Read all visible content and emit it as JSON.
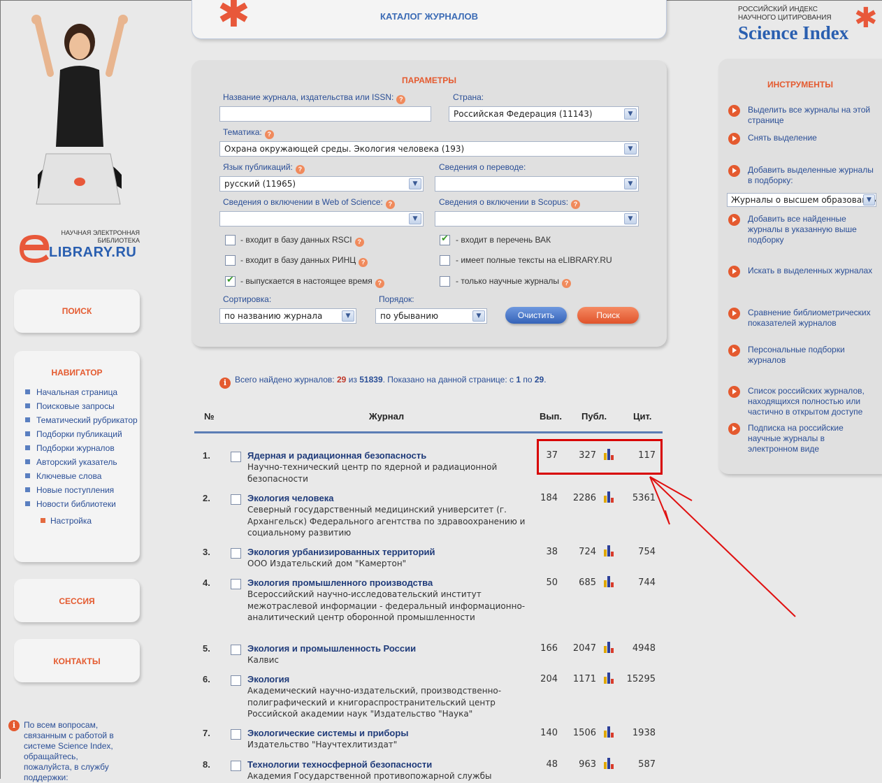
{
  "catalog": {
    "title": "КАТАЛОГ ЖУРНАЛОВ"
  },
  "library": {
    "logo_small": "НАУЧНАЯ ЭЛЕКТРОННАЯ БИБЛИОТЕКА",
    "logo_big": "LIBRARY.RU",
    "logo_letter": "e"
  },
  "science_index": {
    "small": "РОССИЙСКИЙ ИНДЕКС НАУЧНОГО ЦИТИРОВАНИЯ",
    "big": "Science Index"
  },
  "left": {
    "search_label": "ПОИСК",
    "navigator_title": "НАВИГАТОР",
    "navigator_items": [
      "Начальная страница",
      "Поисковые запросы",
      "Тематический рубрикатор",
      "Подборки публикаций",
      "Подборки журналов",
      "Авторский указатель",
      "Ключевые слова",
      "Новые поступления",
      "Новости библиотеки"
    ],
    "settings_label": "Настройка",
    "session_label": "СЕССИЯ",
    "contacts_label": "КОНТАКТЫ",
    "help_text": "По всем вопросам, связанным с работой в системе Science Index, обращайтесь, пожалуйста, в службу поддержки:"
  },
  "params": {
    "title": "ПАРАМЕТРЫ",
    "journal_name_label": "Название журнала, издательства или ISSN:",
    "journal_name_value": "",
    "country_label": "Страна:",
    "country_value": "Российская Федерация  (11143)",
    "topic_label": "Тематика:",
    "topic_value": "Охрана окружающей среды. Экология человека  (193)",
    "language_label": "Язык публикаций:",
    "language_value": "русский  (11965)",
    "translation_label": "Сведения о переводе:",
    "translation_value": "",
    "wos_label": "Сведения о включении в Web of Science:",
    "wos_value": "",
    "scopus_label": "Сведения о включении в Scopus:",
    "scopus_value": "",
    "checkboxes": [
      {
        "label": "- входит в базу данных RSCI",
        "checked": false,
        "help": true
      },
      {
        "label": "- входит в перечень ВАК",
        "checked": true,
        "help": false
      },
      {
        "label": "- входит в базу данных РИНЦ",
        "checked": false,
        "help": true
      },
      {
        "label": "- имеет полные тексты на eLIBRARY.RU",
        "checked": false,
        "help": false
      },
      {
        "label": "- выпускается в настоящее время",
        "checked": true,
        "help": true
      },
      {
        "label": "- только научные журналы",
        "checked": false,
        "help": true
      }
    ],
    "sort_label": "Сортировка:",
    "sort_value": "по названию журнала",
    "order_label": "Порядок:",
    "order_value": "по убыванию",
    "clear_button": "Очистить",
    "search_button": "Поиск",
    "help_mark": "?",
    "arrow_glyph": "▼"
  },
  "summary": {
    "prefix": "Всего найдено журналов:",
    "found": "29",
    "of": "из",
    "total": "51839",
    "shown_prefix": ". Показано на данной странице: с",
    "from": "1",
    "to_word": "по",
    "to": "29",
    "end": "."
  },
  "table": {
    "headers": {
      "num": "№",
      "journal": "Журнал",
      "issues": "Вып.",
      "pubs": "Публ.",
      "cites": "Цит."
    },
    "rows": [
      {
        "num": "1.",
        "title": "Ядерная и радиационная безопасность",
        "desc": "Научно-технический центр по ядерной и радиационной безопасности",
        "issues": "37",
        "pubs": "327",
        "cites": "117"
      },
      {
        "num": "2.",
        "title": "Экология человека",
        "desc": "Северный государственный медицинский университет (г. Архангельск) Федерального агентства по здравоохранению и социальному развитию",
        "issues": "184",
        "pubs": "2286",
        "cites": "5361"
      },
      {
        "num": "3.",
        "title": "Экология урбанизированных территорий",
        "desc": "ООО Издательский дом \"Камертон\"",
        "issues": "38",
        "pubs": "724",
        "cites": "754"
      },
      {
        "num": "4.",
        "title": "Экология промышленного производства",
        "desc": "Всероссийский научно-исследовательский институт межотраслевой информации - федеральный информационно-аналитический центр оборонной промышленности",
        "issues": "50",
        "pubs": "685",
        "cites": "744"
      },
      {
        "num": "5.",
        "title": "Экология и промышленность России",
        "desc": "Калвис",
        "issues": "166",
        "pubs": "2047",
        "cites": "4948"
      },
      {
        "num": "6.",
        "title": "Экология",
        "desc": "Академический научно-издательский, производственно-полиграфический и книгораспространительский центр Российской академии наук \"Издательство \"Наука\"",
        "issues": "204",
        "pubs": "1171",
        "cites": "15295"
      },
      {
        "num": "7.",
        "title": "Экологические системы и приборы",
        "desc": "Издательство \"Научтехлитиздат\"",
        "issues": "140",
        "pubs": "1506",
        "cites": "1938"
      },
      {
        "num": "8.",
        "title": "Технологии техносферной безопасности",
        "desc": "Академия Государственной противопожарной службы",
        "issues": "48",
        "pubs": "963",
        "cites": "587"
      }
    ]
  },
  "tools": {
    "title": "ИНСТРУМЕНТЫ",
    "items": [
      "Выделить все журналы на этой странице",
      "Снять выделение",
      "Добавить выделенные журналы в подборку:",
      "Добавить все найденные журналы в указанную выше подборку",
      "Искать в выделенных журналах",
      "Сравнение библиометрических показателей журналов",
      "Персональные подборки журналов",
      "Список российских журналов, находящихся полностью или частично в открытом доступе",
      "Подписка на российские научные журналы в электронном виде"
    ],
    "collection_select": "Журналы о высшем образовании"
  },
  "colors": {
    "accent_red": "#e45a2f",
    "link_blue": "#2a4e96",
    "highlight": "#d80000"
  }
}
